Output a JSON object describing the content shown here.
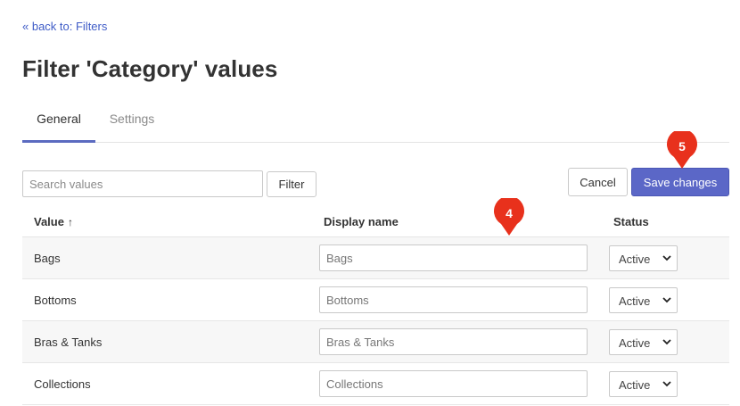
{
  "nav": {
    "back_label": "« back to: Filters"
  },
  "page": {
    "title": "Filter 'Category' values"
  },
  "tabs": [
    {
      "label": "General",
      "active": true
    },
    {
      "label": "Settings",
      "active": false
    }
  ],
  "toolbar": {
    "search_placeholder": "Search values",
    "filter_label": "Filter",
    "cancel_label": "Cancel",
    "save_label": "Save changes"
  },
  "table": {
    "headers": {
      "value": "Value",
      "sort_icon": "↑",
      "display": "Display name",
      "status": "Status"
    },
    "rows": [
      {
        "value": "Bags",
        "display": "Bags",
        "status": "Active"
      },
      {
        "value": "Bottoms",
        "display": "Bottoms",
        "status": "Active"
      },
      {
        "value": "Bras & Tanks",
        "display": "Bras & Tanks",
        "status": "Active"
      },
      {
        "value": "Collections",
        "display": "Collections",
        "status": "Active"
      }
    ]
  },
  "annotations": [
    {
      "number": "4"
    },
    {
      "number": "5"
    }
  ],
  "colors": {
    "accent": "#5b67c7",
    "link": "#3f5cc7",
    "marker": "#e8311c"
  }
}
